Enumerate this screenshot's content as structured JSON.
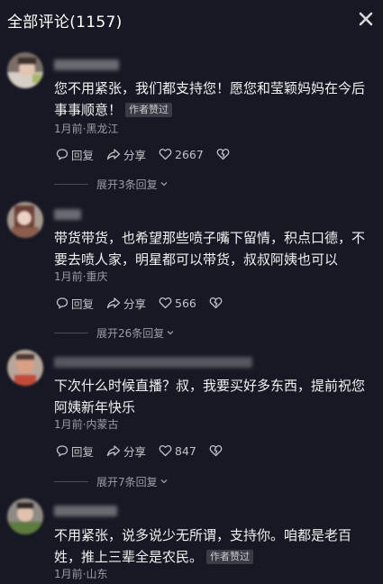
{
  "header": {
    "title": "全部评论(1157)"
  },
  "comments": [
    {
      "text": "您不用紧张，我们都支持您！愿您和莹颖妈妈在今后事事顺意！",
      "badge": "作者赞过",
      "meta": "1月前·黑龙江",
      "reply_label": "回复",
      "share_label": "分享",
      "likes": "2667",
      "expand": "展开3条回复"
    },
    {
      "text": "带货带货，也希望那些喷子嘴下留情，积点口德，不要去喷人家，明星都可以带货，叔叔阿姨也可以",
      "badge": "",
      "meta": "1月前·重庆",
      "reply_label": "回复",
      "share_label": "分享",
      "likes": "566",
      "expand": "展开26条回复"
    },
    {
      "text": "下次什么时候直播？叔，我要买好多东西，提前祝您阿姨新年快乐",
      "badge": "",
      "meta": "1月前·内蒙古",
      "reply_label": "回复",
      "share_label": "分享",
      "likes": "847",
      "expand": "展开7条回复"
    },
    {
      "text": "不用紧张，说多说少无所谓，支持你。咱都是老百姓，推上三辈全是农民。",
      "badge": "作者赞过",
      "meta": "1月前·山东",
      "reply_label": "",
      "share_label": "",
      "likes": "",
      "expand": ""
    }
  ]
}
